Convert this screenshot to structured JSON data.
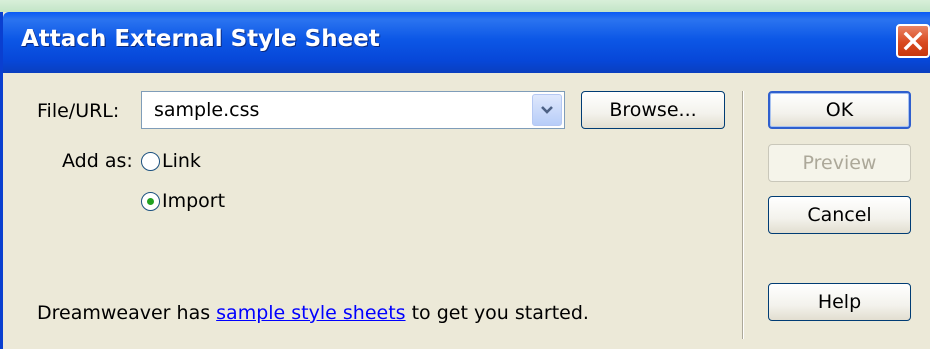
{
  "window": {
    "title": "Attach External Style Sheet",
    "close_icon": "close-icon"
  },
  "form": {
    "file_url_label": "File/URL:",
    "file_url_value": "sample.css",
    "browse_label": "Browse...",
    "add_as_label": "Add as:",
    "options": [
      {
        "label": "Link",
        "selected": false
      },
      {
        "label": "Import",
        "selected": true
      }
    ]
  },
  "buttons": {
    "ok": "OK",
    "preview": "Preview",
    "cancel": "Cancel",
    "help": "Help"
  },
  "footer": {
    "before": "Dreamweaver has ",
    "link": "sample style sheets",
    "after": " to get you started."
  },
  "colors": {
    "titlebar": "#0a5bf5",
    "dialog_bg": "#ece9d8",
    "close_button": "#d9491f",
    "link": "#0000ff",
    "radio_dot": "#21a121"
  }
}
